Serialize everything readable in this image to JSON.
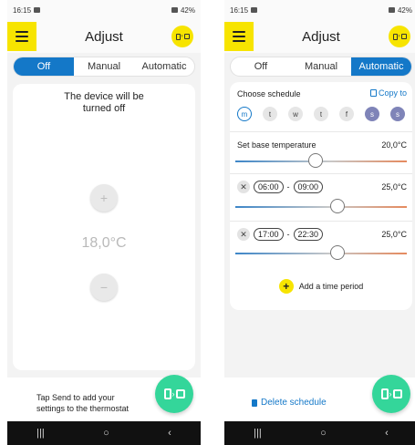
{
  "left": {
    "status": {
      "time": "16:15",
      "battery": "42%"
    },
    "appbar": {
      "title": "Adjust"
    },
    "tabs": [
      {
        "label": "Off"
      },
      {
        "label": "Manual"
      },
      {
        "label": "Automatic"
      }
    ],
    "active_tab": "Off",
    "off_message_line1": "The device will be",
    "off_message_line2": "turned off",
    "plus_label": "+",
    "minus_label": "−",
    "temperature": "18,0°C",
    "hint_line1": "Tap Send to add your",
    "hint_line2": "settings to the thermostat"
  },
  "right": {
    "status": {
      "time": "16:15",
      "battery": "42%"
    },
    "appbar": {
      "title": "Adjust"
    },
    "tabs": [
      {
        "label": "Off"
      },
      {
        "label": "Manual"
      },
      {
        "label": "Automatic"
      }
    ],
    "active_tab": "Automatic",
    "schedule": {
      "title": "Choose schedule",
      "copy_label": "Copy to",
      "days": [
        {
          "label": "m"
        },
        {
          "label": "t"
        },
        {
          "label": "w"
        },
        {
          "label": "t"
        },
        {
          "label": "f"
        },
        {
          "label": "s"
        },
        {
          "label": "s"
        }
      ]
    },
    "base": {
      "label": "Set base temperature",
      "value": "20,0°C"
    },
    "periods": [
      {
        "start": "06:00",
        "sep": "-",
        "end": "09:00",
        "value": "25,0°C"
      },
      {
        "start": "17:00",
        "sep": "-",
        "end": "22:30",
        "value": "25,0°C"
      }
    ],
    "add_period_label": "Add a time period",
    "delete_label": "Delete schedule"
  },
  "colors": {
    "accent": "#1478c8",
    "yellow": "#f7e400",
    "green": "#34d69a",
    "weekend": "#7f84b8"
  },
  "nav": {
    "recent": "|||",
    "home": "○",
    "back": "‹"
  }
}
